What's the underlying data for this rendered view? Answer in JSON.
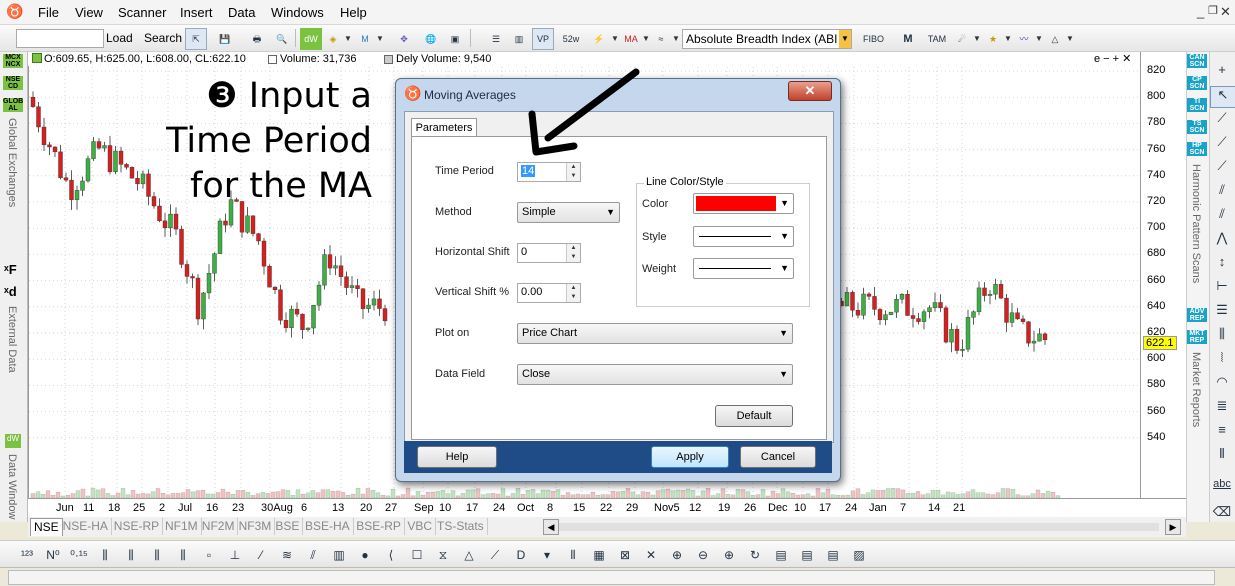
{
  "menu": {
    "items": [
      "File",
      "View",
      "Scanner",
      "Insert",
      "Data",
      "Windows",
      "Help"
    ]
  },
  "toolbar": {
    "load_label": "Load",
    "search_label": "Search",
    "indicator_select": "Absolute Breadth Index (ABI"
  },
  "chart_info": {
    "ohlc": "O:609.65, H:625.00, L:608.00, CL:622.10",
    "volume": "Volume: 31,736",
    "dely_volume": "Dely Volume: 9,540",
    "zoom_controls": "e − + ✕"
  },
  "annotation": {
    "bullet": "❸",
    "line1": "Input a",
    "line2": "Time Period",
    "line3": "for the MA"
  },
  "yaxis": {
    "ticks": [
      "820",
      "800",
      "780",
      "760",
      "740",
      "720",
      "700",
      "680",
      "660",
      "640",
      "620",
      "600",
      "580",
      "560",
      "540"
    ],
    "current": "622.1"
  },
  "xaxis": {
    "labels": [
      "Jun",
      "11",
      "18",
      "25",
      "2",
      "Jul",
      "16",
      "23",
      "30Aug",
      "6",
      "13",
      "20",
      "27",
      "Sep",
      "10",
      "17",
      "24",
      "Oct",
      "8",
      "15",
      "22",
      "29",
      "Nov5",
      "12",
      "19",
      "26",
      "Dec",
      "10",
      "17",
      "24",
      "Jan",
      "7",
      "14",
      "21"
    ]
  },
  "tabs": [
    "NSE",
    "NSE-HA",
    "NSE-RP",
    "NF1M",
    "NF2M",
    "NF3M",
    "BSE",
    "BSE-HA",
    "BSE-RP",
    "VBC",
    "TS-Stats"
  ],
  "left_panel": {
    "exchanges": [
      "MCX NCX",
      "NSE CD",
      "GLOB AL"
    ],
    "global_label": "Global Exchanges",
    "external_label": "External Data",
    "data_window_label": "Data Window"
  },
  "right_panel": {
    "scans": [
      "CAN SCN",
      "CP SCN",
      "TI SCN",
      "TS SCN",
      "HP SCN"
    ],
    "harmonic_label": "Harmonic Pattern Scans",
    "reports": [
      "ADV REP",
      "MKT REP"
    ],
    "market_reports_label": "Market Reports",
    "abc": "abc"
  },
  "dialog": {
    "title": "Moving Averages",
    "close": "✕",
    "tab": "Parameters",
    "time_period_label": "Time Period",
    "time_period": "14",
    "method_label": "Method",
    "method": "Simple",
    "hshift_label": "Horizontal Shift",
    "hshift": "0",
    "vshift_label": "Vertical Shift %",
    "vshift": "0.00",
    "plot_on_label": "Plot on",
    "plot_on": "Price Chart",
    "data_field_label": "Data Field",
    "data_field": "Close",
    "group_label": "Line Color/Style",
    "color_label": "Color",
    "color_value": "#ff0000",
    "style_label": "Style",
    "weight_label": "Weight",
    "default_btn": "Default",
    "help_btn": "Help",
    "apply_btn": "Apply",
    "cancel_btn": "Cancel"
  },
  "colors": {
    "bull": "#3cb043",
    "bear": "#d62020",
    "dialog_footer": "#1f4c86"
  }
}
